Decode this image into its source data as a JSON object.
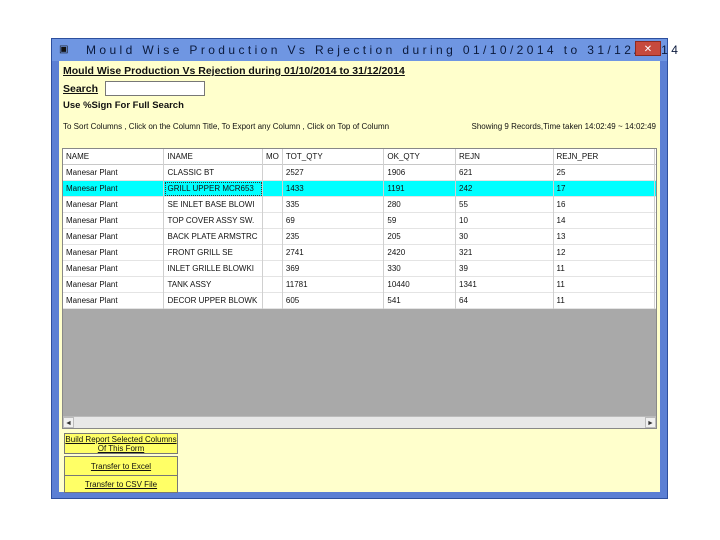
{
  "window": {
    "title": "Mould Wise Production Vs Rejection during 01/10/2014 to 31/12/2014",
    "close_label": "✕"
  },
  "report": {
    "heading": "Mould Wise Production Vs Rejection during 01/10/2014 to 31/12/2014",
    "search_label": "Search",
    "search_value": "",
    "search_hint": "Use %Sign For Full Search",
    "instructions": "To Sort Columns , Click on the Column Title, To Export any Column , Click on Top of Column",
    "status": "Showing 9 Records,Time taken 14:02:49 ~ 14:02:49"
  },
  "grid": {
    "columns": [
      "NAME",
      "INAME",
      "MO",
      "TOT_QTY",
      "OK_QTY",
      "REJN",
      "REJN_PER",
      ""
    ],
    "rows": [
      [
        "Manesar Plant",
        "CLASSIC BT",
        "",
        "2527",
        "1906",
        "621",
        "25",
        ""
      ],
      [
        "Manesar Plant",
        "GRILL UPPER MCR653",
        "",
        "1433",
        "1191",
        "242",
        "17",
        ""
      ],
      [
        "Manesar Plant",
        "SE INLET BASE BLOWI",
        "",
        "335",
        "280",
        "55",
        "16",
        ""
      ],
      [
        "Manesar Plant",
        "TOP COVER ASSY SW.",
        "",
        "69",
        "59",
        "10",
        "14",
        ""
      ],
      [
        "Manesar Plant",
        "BACK PLATE ARMSTRC",
        "",
        "235",
        "205",
        "30",
        "13",
        ""
      ],
      [
        "Manesar Plant",
        "FRONT GRILL SE",
        "",
        "2741",
        "2420",
        "321",
        "12",
        ""
      ],
      [
        "Manesar Plant",
        "INLET GRILLE BLOWKI",
        "",
        "369",
        "330",
        "39",
        "11",
        ""
      ],
      [
        "Manesar Plant",
        "TANK ASSY",
        "",
        "11781",
        "10440",
        "1341",
        "11",
        ""
      ],
      [
        "Manesar Plant",
        "DECOR UPPER BLOWK",
        "",
        "605",
        "541",
        "64",
        "11",
        ""
      ]
    ],
    "selected_row": 1
  },
  "buttons": {
    "build_report": "Build Report Selected Columns Of This Form",
    "excel": "Transfer to Excel",
    "csv": "Transfer to CSV File"
  },
  "scroll": {
    "left_icon": "◄",
    "right_icon": "►"
  },
  "colors": {
    "title_bar": "#6f96e2",
    "form_bg": "#ffffcc",
    "selected_row": "#00ffff",
    "button_bg": "#ffff66"
  }
}
